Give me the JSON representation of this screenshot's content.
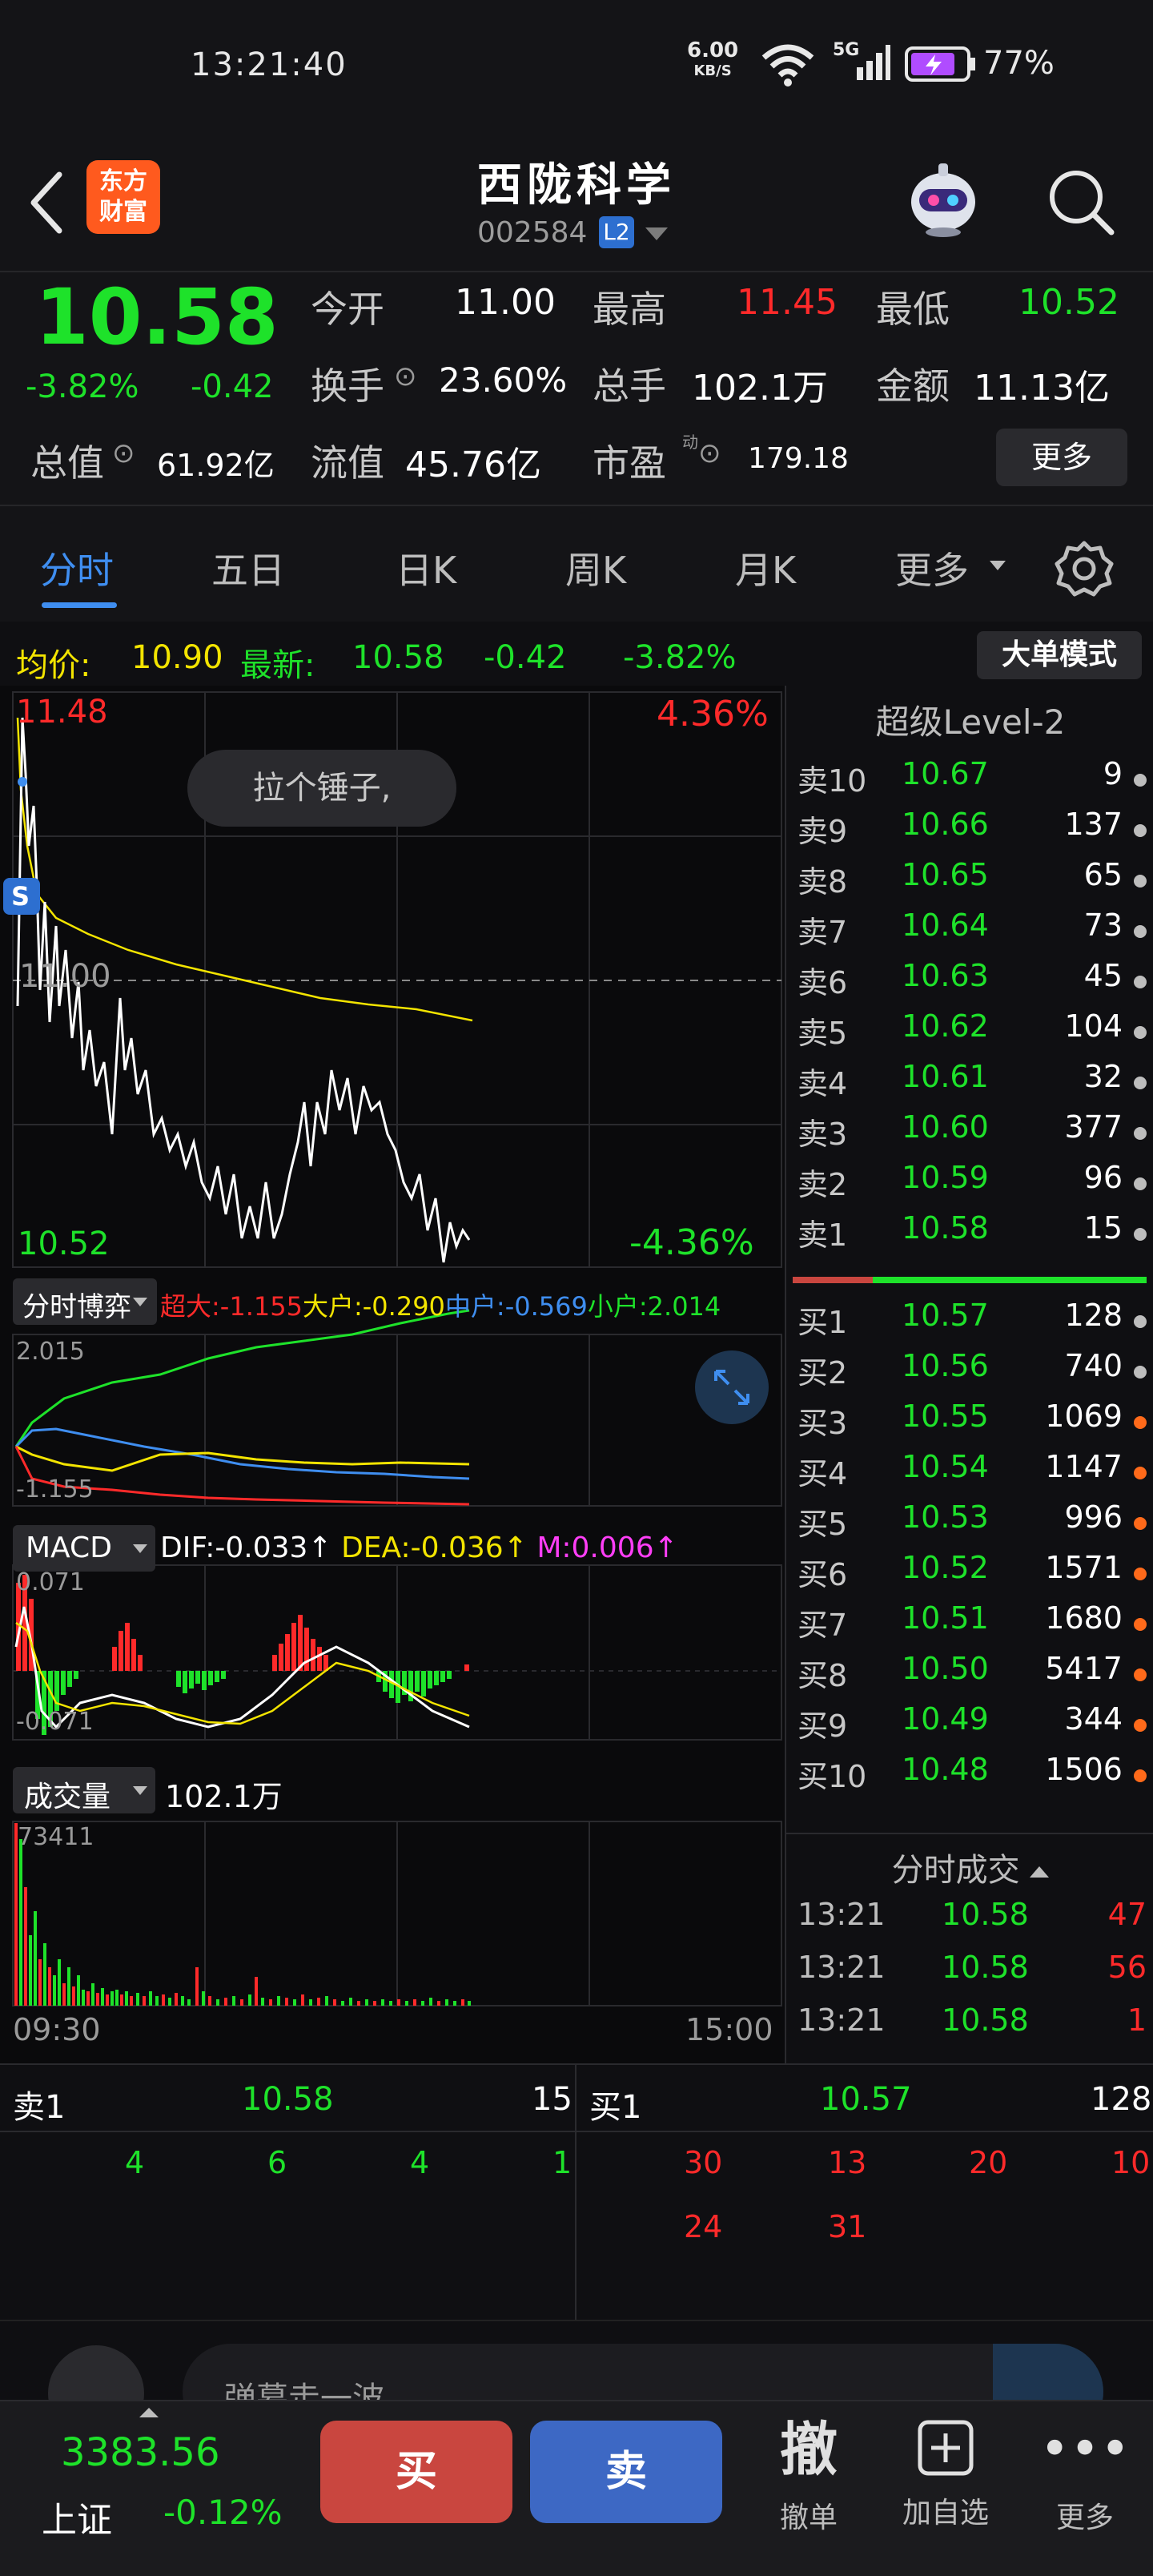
{
  "status_bar": {
    "time": "13:21:40",
    "net_speed": "6.00",
    "net_unit": "KB/S",
    "network": "5G",
    "battery": "77%"
  },
  "header": {
    "logo_line1": "东方",
    "logo_line2": "财富",
    "stock_name": "西陇科学",
    "stock_code": "002584",
    "level_badge": "L2"
  },
  "quote": {
    "price": "10.58",
    "change_pct": "-3.82%",
    "change": "-0.42",
    "open_label": "今开",
    "open": "11.00",
    "high_label": "最高",
    "high": "11.45",
    "low_label": "最低",
    "low": "10.52",
    "turnover_label": "换手",
    "turnover": "23.60%",
    "volume_label": "总手",
    "volume": "102.1万",
    "amount_label": "金额",
    "amount": "11.13亿",
    "mktcap_label": "总值",
    "mktcap": "61.92亿",
    "float_label": "流值",
    "float": "45.76亿",
    "pe_label": "市盈",
    "pe_sup": "动",
    "pe": "179.18",
    "more_label": "更多"
  },
  "tabs": [
    {
      "label": "分时",
      "active": true
    },
    {
      "label": "五日",
      "active": false
    },
    {
      "label": "日K",
      "active": false
    },
    {
      "label": "周K",
      "active": false
    },
    {
      "label": "月K",
      "active": false
    },
    {
      "label": "更多",
      "active": false
    }
  ],
  "info_line": {
    "avg_label": "均价:",
    "avg": "10.90",
    "latest_label": "最新:",
    "latest": "10.58",
    "chg": "-0.42",
    "pct": "-3.82%",
    "mode_button": "大单模式"
  },
  "intraday": {
    "top_price": "11.48",
    "top_pct": "4.36%",
    "ref_price": "11.00",
    "bottom_price": "10.52",
    "bottom_pct": "-4.36%",
    "bubble": "拉个锤子,",
    "marker": "S",
    "time_start": "09:30",
    "time_end": "15:00"
  },
  "fund_flow": {
    "selector": "分时博弈",
    "super_label": "超大:",
    "super": "-1.155",
    "large_label": "大户:",
    "large": "-0.290",
    "mid_label": "中户:",
    "mid": "-0.569",
    "small_label": "小户:",
    "small": "2.014",
    "axis_top": "2.015",
    "axis_bottom": "-1.155"
  },
  "macd": {
    "selector": "MACD",
    "dif_label": "DIF:",
    "dif": "-0.033",
    "dea_label": "DEA:",
    "dea": "-0.036",
    "m_label": "M:",
    "m": "0.006",
    "axis_top": "0.071",
    "axis_bottom": "-0.071"
  },
  "volume_panel": {
    "selector": "成交量",
    "value": "102.1万",
    "axis_top": "73411"
  },
  "order_book": {
    "title": "超级Level-2",
    "asks": [
      {
        "label": "卖10",
        "price": "10.67",
        "vol": "9",
        "dot": "gray"
      },
      {
        "label": "卖9",
        "price": "10.66",
        "vol": "137",
        "dot": "gray"
      },
      {
        "label": "卖8",
        "price": "10.65",
        "vol": "65",
        "dot": "gray"
      },
      {
        "label": "卖7",
        "price": "10.64",
        "vol": "73",
        "dot": "gray"
      },
      {
        "label": "卖6",
        "price": "10.63",
        "vol": "45",
        "dot": "gray"
      },
      {
        "label": "卖5",
        "price": "10.62",
        "vol": "104",
        "dot": "gray"
      },
      {
        "label": "卖4",
        "price": "10.61",
        "vol": "32",
        "dot": "gray"
      },
      {
        "label": "卖3",
        "price": "10.60",
        "vol": "377",
        "dot": "gray"
      },
      {
        "label": "卖2",
        "price": "10.59",
        "vol": "96",
        "dot": "gray"
      },
      {
        "label": "卖1",
        "price": "10.58",
        "vol": "15",
        "dot": "gray"
      }
    ],
    "bids": [
      {
        "label": "买1",
        "price": "10.57",
        "vol": "128",
        "dot": "gray"
      },
      {
        "label": "买2",
        "price": "10.56",
        "vol": "740",
        "dot": "gray"
      },
      {
        "label": "买3",
        "price": "10.55",
        "vol": "1069",
        "dot": "orange"
      },
      {
        "label": "买4",
        "price": "10.54",
        "vol": "1147",
        "dot": "orange"
      },
      {
        "label": "买5",
        "price": "10.53",
        "vol": "996",
        "dot": "orange"
      },
      {
        "label": "买6",
        "price": "10.52",
        "vol": "1571",
        "dot": "orange"
      },
      {
        "label": "买7",
        "price": "10.51",
        "vol": "1680",
        "dot": "orange"
      },
      {
        "label": "买8",
        "price": "10.50",
        "vol": "5417",
        "dot": "orange"
      },
      {
        "label": "买9",
        "price": "10.49",
        "vol": "344",
        "dot": "orange"
      },
      {
        "label": "买10",
        "price": "10.48",
        "vol": "1506",
        "dot": "orange"
      }
    ],
    "ticks_title": "分时成交",
    "ticks": [
      {
        "time": "13:21",
        "price": "10.58",
        "vol": "47"
      },
      {
        "time": "13:21",
        "price": "10.58",
        "vol": "56"
      },
      {
        "time": "13:21",
        "price": "10.58",
        "vol": "1"
      }
    ]
  },
  "queue": {
    "ask_label": "卖1",
    "ask_price": "10.58",
    "ask_vol": "15",
    "ask_orders": [
      "4",
      "6",
      "4",
      "1"
    ],
    "bid_label": "买1",
    "bid_price": "10.57",
    "bid_vol": "128",
    "bid_orders_row1": [
      "30",
      "13",
      "20",
      "10"
    ],
    "bid_orders_row2": [
      "24",
      "31"
    ]
  },
  "comment_bar": {
    "placeholder": "弹幕走一波..."
  },
  "bottom_bar": {
    "index_value": "3383.56",
    "index_name": "上证",
    "index_pct": "-0.12%",
    "buy": "买",
    "sell": "卖",
    "cancel_glyph": "撤",
    "cancel_label": "撤单",
    "add_label": "加自选",
    "more_label": "更多"
  },
  "colors": {
    "up": "#ff2a2a",
    "down": "#1ee22a",
    "accent": "#3f8ef0",
    "buy_button": "#c9463f",
    "sell_button": "#3d68c4"
  }
}
